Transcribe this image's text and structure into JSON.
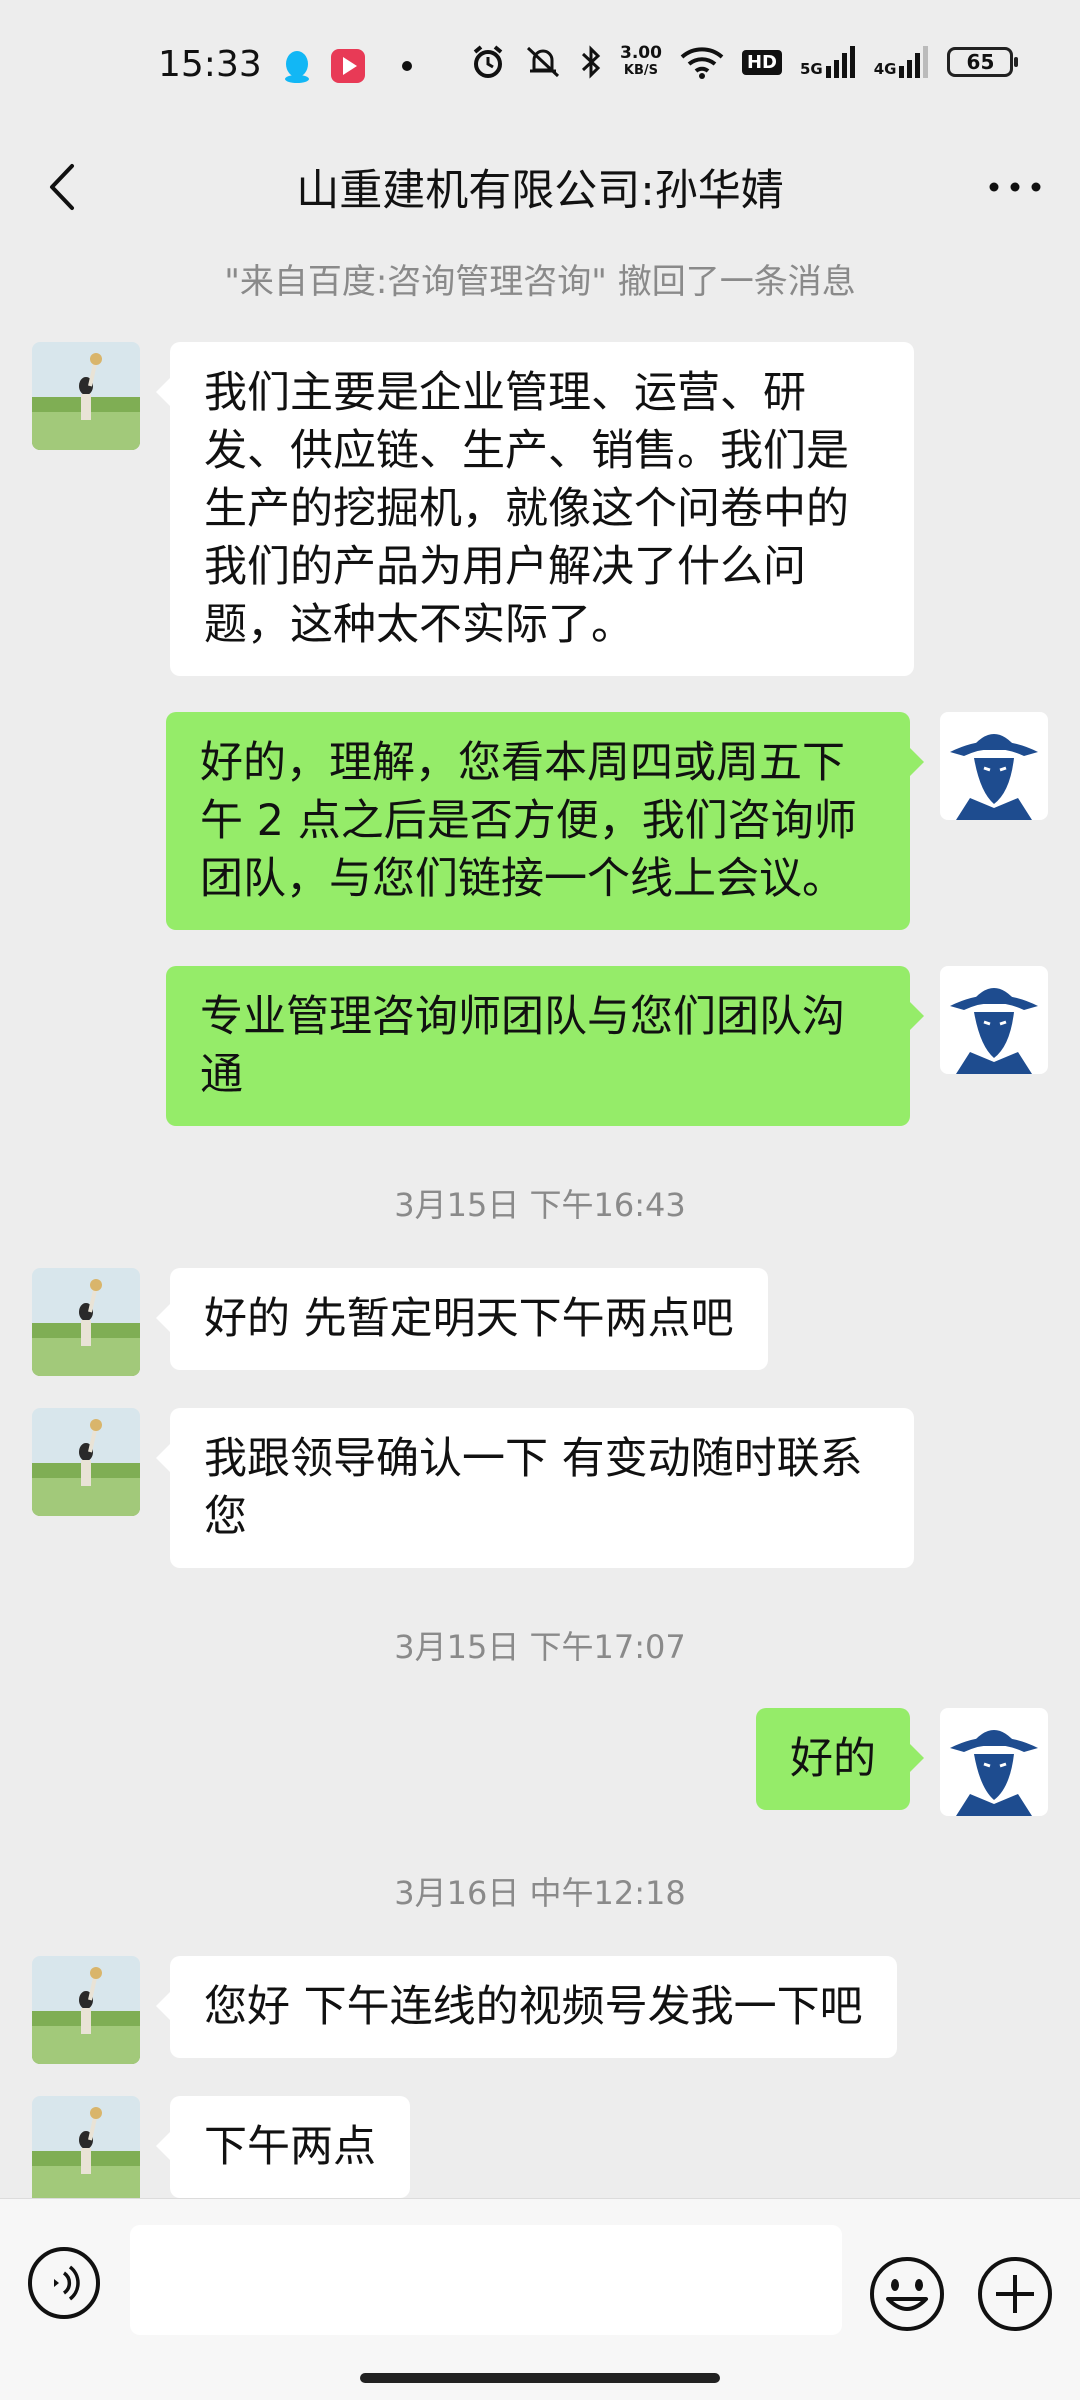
{
  "status_bar": {
    "time": "15:33",
    "speed_value": "3.00",
    "speed_unit": "KB/S",
    "hd_label": "HD",
    "net1_label": "5G",
    "net2_label": "4G",
    "battery": "65",
    "icons": [
      "qq-icon",
      "video-app-icon",
      "dot-icon",
      "alarm-icon",
      "mute-icon",
      "bluetooth-icon",
      "wifi-icon",
      "signal-icon"
    ]
  },
  "nav": {
    "title": "山重建机有限公司:孙华婧",
    "back_icon": "chevron-left-icon",
    "more_icon": "more-icon"
  },
  "recall_notice": "\"来自百度:咨询管理咨询\" 撤回了一条消息",
  "messages": [
    {
      "side": "in",
      "text": "我们主要是企业管理、运营、研发、供应链、生产、销售。我们是生产的挖掘机，就像这个问卷中的我们的产品为用户解决了什么问题，这种太不实际了。"
    },
    {
      "side": "out",
      "text": "好的，理解，您看本周四或周五下午 2 点之后是否方便，我们咨询师团队，与您们链接一个线上会议。"
    },
    {
      "side": "out",
      "text": "专业管理咨询师团队与您们团队沟通"
    },
    {
      "timestamp": "3月15日 下午16:43"
    },
    {
      "side": "in",
      "text": "好的 先暂定明天下午两点吧"
    },
    {
      "side": "in",
      "text": "我跟领导确认一下  有变动随时联系您"
    },
    {
      "timestamp": "3月15日 下午17:07"
    },
    {
      "side": "out",
      "text": "好的"
    },
    {
      "timestamp": "3月16日 中午12:18"
    },
    {
      "side": "in",
      "text": "您好 下午连线的视频号发我一下吧"
    },
    {
      "side": "in",
      "text": "下午两点"
    }
  ],
  "input_bar": {
    "placeholder": "",
    "voice_icon": "voice-icon",
    "emoji_icon": "emoji-icon",
    "plus_icon": "plus-icon"
  },
  "colors": {
    "background": "#ededed",
    "incoming_bubble": "#ffffff",
    "outgoing_bubble": "#95ec69",
    "meta_text": "#8a8a8a"
  }
}
